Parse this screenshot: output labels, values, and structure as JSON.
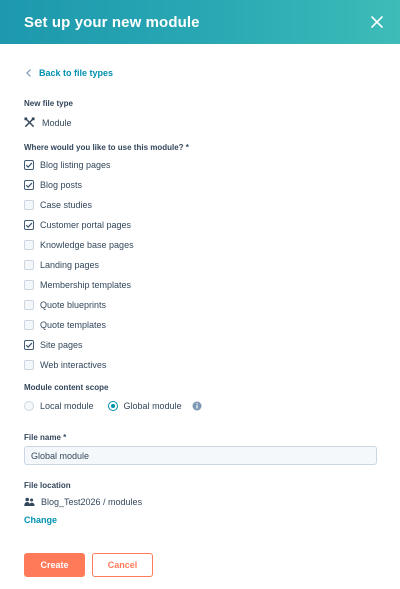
{
  "header": {
    "title": "Set up your new module",
    "close_icon": "close-icon"
  },
  "back_link": {
    "label": "Back to file types"
  },
  "file_type": {
    "section_label": "New file type",
    "value": "Module",
    "icon": "module-tools-icon"
  },
  "usage": {
    "section_label": "Where would you like to use this module? *",
    "options": [
      {
        "label": "Blog listing pages",
        "checked": true
      },
      {
        "label": "Blog posts",
        "checked": true
      },
      {
        "label": "Case studies",
        "checked": false
      },
      {
        "label": "Customer portal pages",
        "checked": true
      },
      {
        "label": "Knowledge base pages",
        "checked": false
      },
      {
        "label": "Landing pages",
        "checked": false
      },
      {
        "label": "Membership templates",
        "checked": false
      },
      {
        "label": "Quote blueprints",
        "checked": false
      },
      {
        "label": "Quote templates",
        "checked": false
      },
      {
        "label": "Site pages",
        "checked": true
      },
      {
        "label": "Web interactives",
        "checked": false
      }
    ]
  },
  "scope": {
    "section_label": "Module content scope",
    "options": [
      {
        "label": "Local module",
        "selected": false
      },
      {
        "label": "Global module",
        "selected": true
      }
    ],
    "info_icon": "info-icon"
  },
  "file_name": {
    "section_label": "File name *",
    "value": "Global module"
  },
  "file_location": {
    "section_label": "File location",
    "path": "Blog_Test2026 / modules",
    "icon": "folder-users-icon",
    "change_label": "Change"
  },
  "actions": {
    "create_label": "Create",
    "cancel_label": "Cancel"
  },
  "colors": {
    "header_gradient_start": "#1d98ad",
    "header_gradient_end": "#3dbcb8",
    "link": "#0091ae",
    "primary_button": "#ff7a59",
    "text": "#33475b"
  }
}
